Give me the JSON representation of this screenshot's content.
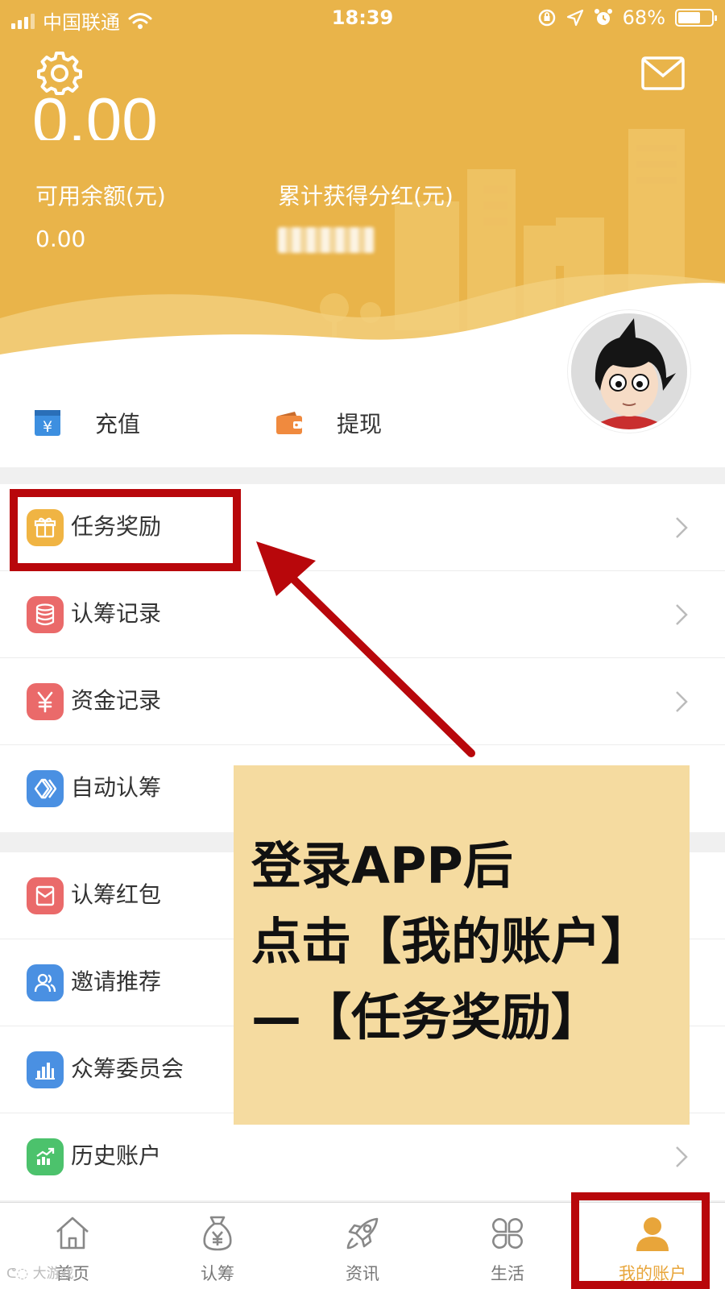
{
  "status_bar": {
    "carrier": "中国联通",
    "time": "18:39",
    "battery": "68%",
    "battery_level": 0.68
  },
  "header": {
    "total_amount": "0.00",
    "available_balance_label": "可用余额(元)",
    "available_balance_value": "0.00",
    "dividend_label": "累计获得分红(元)"
  },
  "actions": {
    "recharge": "充值",
    "withdraw": "提现"
  },
  "menu": {
    "group1": [
      {
        "label": "任务奖励",
        "icon": "gift-icon",
        "color": "#f0b443"
      },
      {
        "label": "认筹记录",
        "icon": "database-icon",
        "color": "#ea6a6a"
      },
      {
        "label": "资金记录",
        "icon": "yuan-icon",
        "color": "#ea6a6a"
      },
      {
        "label": "自动认筹",
        "icon": "auto-icon",
        "color": "#4a90e2"
      }
    ],
    "group2": [
      {
        "label": "认筹红包",
        "icon": "envelope-icon",
        "color": "#ea6a6a"
      },
      {
        "label": "邀请推荐",
        "icon": "users-icon",
        "color": "#4a90e2"
      },
      {
        "label": "众筹委员会",
        "icon": "bar-chart-icon",
        "color": "#4a90e2"
      },
      {
        "label": "历史账户",
        "icon": "trend-icon",
        "color": "#4cc26c"
      }
    ]
  },
  "annotation": {
    "line1": "登录APP后",
    "line2": "点击【我的账户】",
    "line3": "—【任务奖励】"
  },
  "tabbar": {
    "home": "首页",
    "subscribe": "认筹",
    "news": "资讯",
    "life": "生活",
    "account": "我的账户"
  },
  "colors": {
    "header": "#e9b44a",
    "accent": "#e8a53a",
    "highlight": "#b8070b"
  }
}
